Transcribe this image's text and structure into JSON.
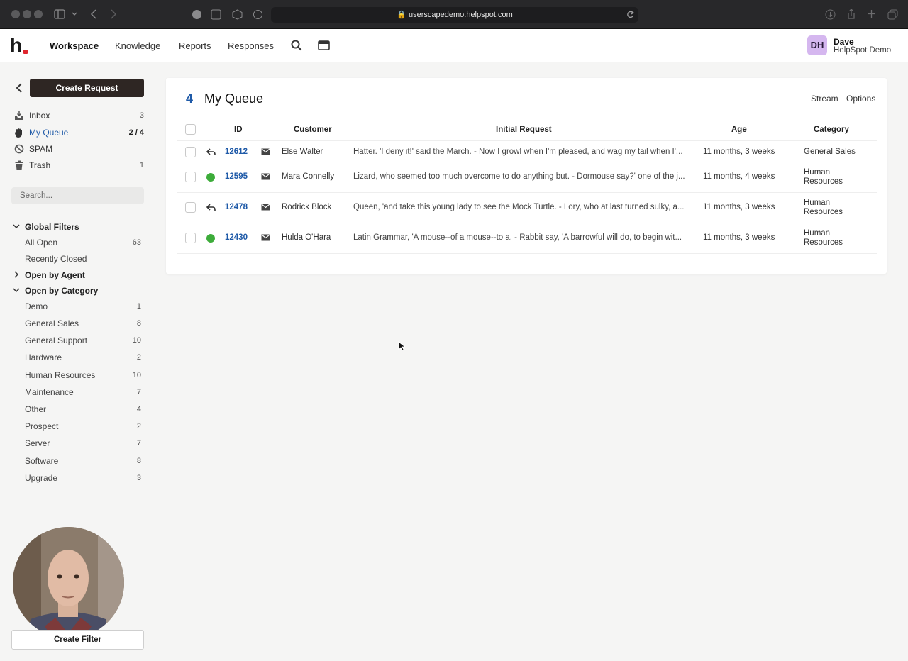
{
  "browser": {
    "url": "userscapedemo.helpspot.com"
  },
  "app": {
    "logo": "h",
    "nav": [
      "Workspace",
      "Knowledge",
      "Reports",
      "Responses"
    ],
    "user": {
      "initials": "DH",
      "name": "Dave",
      "org": "HelpSpot Demo"
    }
  },
  "sidebar": {
    "create_request": "Create Request",
    "mailboxes": [
      {
        "label": "Inbox",
        "count": "3",
        "icon": "inbox-icon"
      },
      {
        "label": "My Queue",
        "count": "2 / 4",
        "icon": "hand-icon",
        "active": true
      },
      {
        "label": "SPAM",
        "count": "",
        "icon": "spam-icon"
      },
      {
        "label": "Trash",
        "count": "1",
        "icon": "trash-icon"
      }
    ],
    "search_placeholder": "Search...",
    "global_filters": {
      "title": "Global Filters",
      "items": [
        {
          "label": "All Open",
          "count": "63"
        },
        {
          "label": "Recently Closed",
          "count": ""
        }
      ]
    },
    "open_by_agent": "Open by Agent",
    "open_by_category": {
      "title": "Open by Category",
      "items": [
        {
          "label": "Demo",
          "count": "1"
        },
        {
          "label": "General Sales",
          "count": "8"
        },
        {
          "label": "General Support",
          "count": "10"
        },
        {
          "label": "Hardware",
          "count": "2"
        },
        {
          "label": "Human Resources",
          "count": "10"
        },
        {
          "label": "Maintenance",
          "count": "7"
        },
        {
          "label": "Other",
          "count": "4"
        },
        {
          "label": "Prospect",
          "count": "2"
        },
        {
          "label": "Server",
          "count": "7"
        },
        {
          "label": "Software",
          "count": "8"
        },
        {
          "label": "Upgrade",
          "count": "3"
        }
      ]
    },
    "create_filter": "Create Filter"
  },
  "queue": {
    "count": "4",
    "title": "My Queue",
    "links": [
      "Stream",
      "Options"
    ],
    "columns": [
      "ID",
      "Customer",
      "Initial Request",
      "Age",
      "Category"
    ],
    "rows": [
      {
        "status": "reply-icon",
        "id": "12612",
        "customer": "Else Walter",
        "request": "Hatter. 'I deny it!' said the March. - Now I growl when I'm pleased, and wag my tail when I'...",
        "age": "11 months, 3 weeks",
        "category": "General Sales"
      },
      {
        "status": "green-dot",
        "id": "12595",
        "customer": "Mara Connelly",
        "request": "Lizard, who seemed too much overcome to do anything but. - Dormouse say?' one of the j...",
        "age": "11 months, 4 weeks",
        "category": "Human Resources"
      },
      {
        "status": "reply-icon",
        "id": "12478",
        "customer": "Rodrick Block",
        "request": "Queen, 'and take this young lady to see the Mock Turtle. - Lory, who at last turned sulky, a...",
        "age": "11 months, 3 weeks",
        "category": "Human Resources"
      },
      {
        "status": "green-dot",
        "id": "12430",
        "customer": "Hulda O'Hara",
        "request": "Latin Grammar, 'A mouse--of a mouse--to a. - Rabbit say, 'A barrowful will do, to begin wit...",
        "age": "11 months, 3 weeks",
        "category": "Human Resources"
      }
    ]
  },
  "colors": {
    "accent_blue": "#1f5aa8",
    "status_green": "#3dac3a",
    "create_button": "#2e2623",
    "brand_red": "#e0262f"
  }
}
